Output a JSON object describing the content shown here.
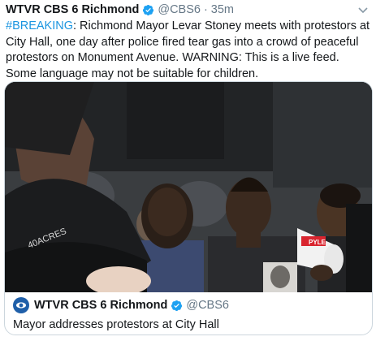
{
  "tweet": {
    "author_name": "WTVR CBS 6 Richmond",
    "handle": "@CBS6",
    "separator": "·",
    "time": "35m",
    "hashtag": "#BREAKING",
    "body": ": Richmond Mayor Levar Stoney meets with protestors at City Hall, one day after police fired tear gas into a crowd of peaceful protestors on Monument Avenue. WARNING: This is a live feed. Some language may not be suitable for children."
  },
  "card": {
    "author_name": "WTVR CBS 6 Richmond",
    "handle": "@CBS6",
    "title": "Mayor addresses protestors at City Hall"
  },
  "video": {
    "hat_text": "40ACRES",
    "megaphone_text": "PYLE"
  },
  "colors": {
    "link": "#1b95e0",
    "verified": "#1da1f2",
    "secondary_text": "#657786",
    "border": "#ccd6dd"
  }
}
